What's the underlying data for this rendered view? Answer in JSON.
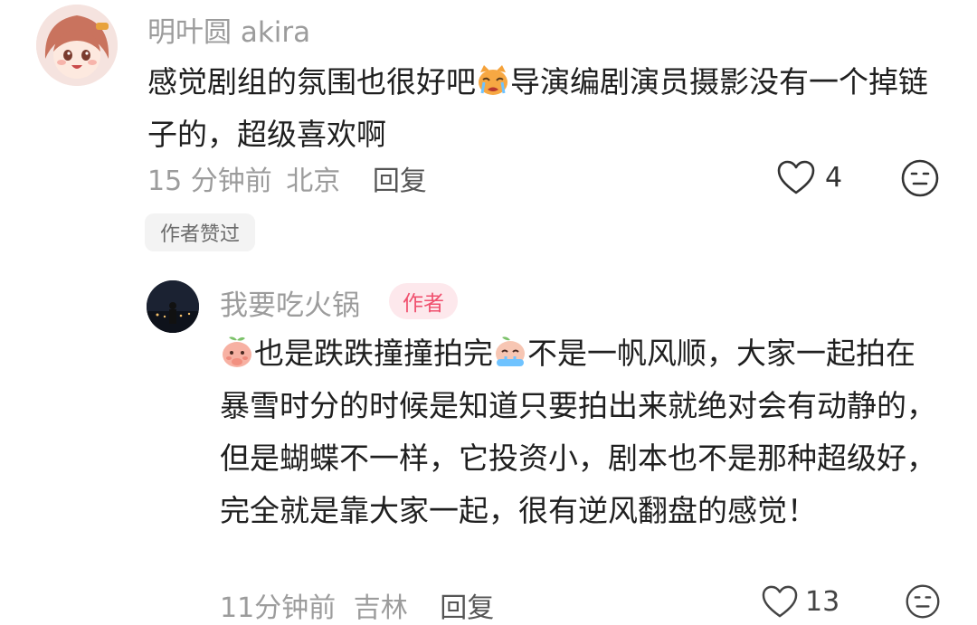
{
  "comments": [
    {
      "username": "明叶圆 akira",
      "text_a": "感觉剧组的氛围也很好吧",
      "emoji_1": "cat-crying-emoji",
      "text_b": "导演编剧演员摄影没有一个掉链子的，超级喜欢啊",
      "time": "15 分钟前",
      "location": "北京",
      "reply_label": "回复",
      "like_count": "4",
      "author_liked": "作者赞过"
    },
    {
      "username": "我要吃火锅",
      "author_badge": "作者",
      "emoji_1": "peach-shy-emoji",
      "text_a": "也是跌跌撞撞拍完",
      "emoji_2": "peach-cry-emoji",
      "text_b": "不是一帆风顺，大家一起拍在暴雪时分的时候是知道只要拍出来就绝对会有动静的，但是蝴蝶不一样，它投资小，剧本也不是那种超级好，完全就是靠大家一起，很有逆风翻盘的感觉！",
      "time": "11分钟前",
      "location": "吉林",
      "reply_label": "回复",
      "like_count": "13"
    }
  ],
  "colors": {
    "meta_gray": "#9c9c9c",
    "author_pink": "#f0506e",
    "author_bg": "#fde8ec"
  }
}
